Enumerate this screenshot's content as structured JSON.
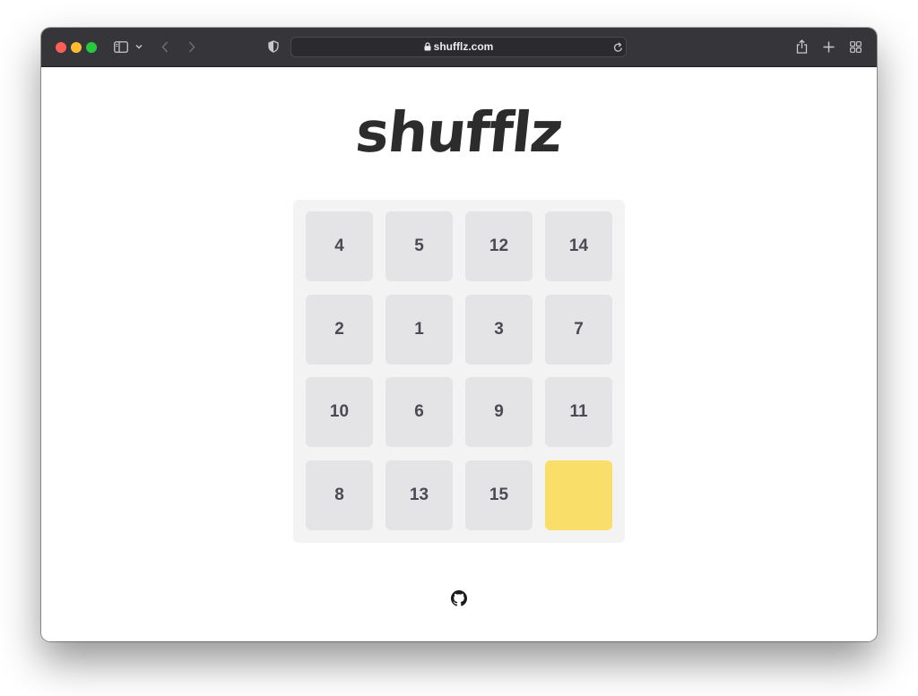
{
  "browser": {
    "url": "shufflz.com",
    "traffic_lights": {
      "close": "#ff5f57",
      "minimize": "#febc2e",
      "zoom": "#28c840"
    },
    "icons": [
      "sidebar-icon",
      "chevron-down-icon",
      "back-icon",
      "forward-icon",
      "shield-icon",
      "lock-icon",
      "reload-icon",
      "share-icon",
      "new-tab-icon",
      "tab-overview-icon"
    ]
  },
  "app": {
    "title": "shufflz",
    "empty_tile_color": "#f9de69",
    "tile_color": "#e4e4e7",
    "tiles": [
      [
        "4",
        "5",
        "12",
        "14"
      ],
      [
        "2",
        "1",
        "3",
        "7"
      ],
      [
        "10",
        "6",
        "9",
        "11"
      ],
      [
        "8",
        "13",
        "15",
        ""
      ]
    ]
  },
  "footer": {
    "icon": "github-icon"
  }
}
